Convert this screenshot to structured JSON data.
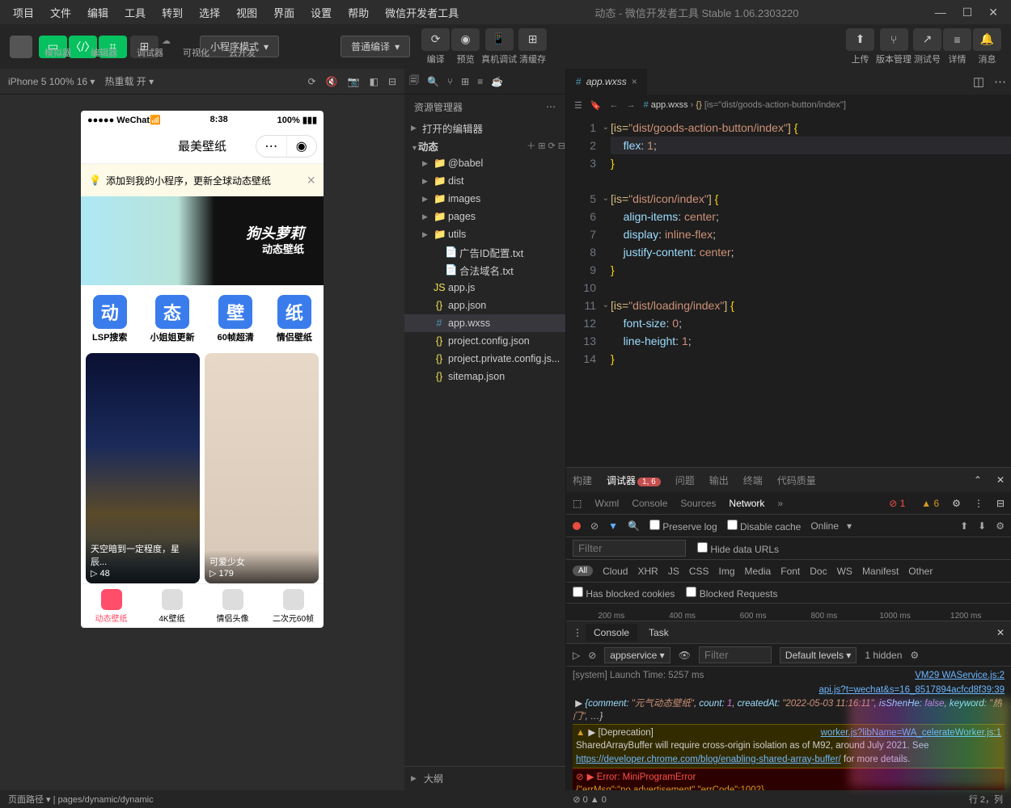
{
  "window": {
    "title": "动态 - 微信开发者工具 Stable 1.06.2303220"
  },
  "menu": [
    "项目",
    "文件",
    "编辑",
    "工具",
    "转到",
    "选择",
    "视图",
    "界面",
    "设置",
    "帮助",
    "微信开发者工具"
  ],
  "toolbar": {
    "cols": [
      "模拟器",
      "编辑器",
      "调试器",
      "可视化",
      "云开发"
    ],
    "mode": "小程序模式",
    "compile": "普通编译",
    "actions": [
      "编译",
      "预览",
      "真机调试",
      "清缓存"
    ],
    "right": [
      "上传",
      "版本管理",
      "测试号",
      "详情",
      "消息"
    ]
  },
  "device": {
    "name": "iPhone 5 100% 16",
    "hot": "热重载 开"
  },
  "phone": {
    "carrier": "WeChat",
    "time": "8:38",
    "battery": "100%",
    "appTitle": "最美壁纸",
    "notice": "添加到我的小程序，更新全球动态壁纸",
    "bannerTitle": "狗头萝莉",
    "bannerSub": "动态壁纸",
    "grid": [
      {
        "icon": "动",
        "label": "LSP搜索"
      },
      {
        "icon": "态",
        "label": "小姐姐更新"
      },
      {
        "icon": "壁",
        "label": "60帧超清"
      },
      {
        "icon": "纸",
        "label": "情侣壁纸"
      }
    ],
    "card1": {
      "title": "天空暗到一定程度，星辰...",
      "plays": "48"
    },
    "card2": {
      "title": "可爱少女",
      "plays": "179"
    },
    "tabs": [
      "动态壁纸",
      "4K壁纸",
      "情侣头像",
      "二次元60帧"
    ]
  },
  "explorer": {
    "title": "资源管理器",
    "openEditors": "打开的编辑器",
    "root": "动态",
    "outline": "大纲",
    "tree": [
      {
        "d": 1,
        "t": "folder",
        "n": "@babel"
      },
      {
        "d": 1,
        "t": "folder",
        "c": "#e06c75",
        "n": "dist"
      },
      {
        "d": 1,
        "t": "folder",
        "c": "#5ec17a",
        "n": "images"
      },
      {
        "d": 1,
        "t": "folder",
        "c": "#e06c75",
        "n": "pages"
      },
      {
        "d": 1,
        "t": "folder",
        "c": "#5ec17a",
        "n": "utils"
      },
      {
        "d": 2,
        "t": "txt",
        "n": "广告ID配置.txt"
      },
      {
        "d": 2,
        "t": "txt",
        "n": "合法域名.txt"
      },
      {
        "d": 1,
        "t": "js",
        "n": "app.js"
      },
      {
        "d": 1,
        "t": "json",
        "n": "app.json"
      },
      {
        "d": 1,
        "t": "css",
        "n": "app.wxss",
        "sel": true
      },
      {
        "d": 1,
        "t": "json",
        "n": "project.config.json"
      },
      {
        "d": 1,
        "t": "json",
        "n": "project.private.config.js..."
      },
      {
        "d": 1,
        "t": "json",
        "n": "sitemap.json"
      }
    ]
  },
  "editor": {
    "tab": "app.wxss",
    "crumb": [
      "app.wxss",
      "{}",
      " [is=\"dist/goods-action-button/index\"]"
    ],
    "lines": [
      {
        "n": 1,
        "t": "[is=\"dist/goods-action-button/index\"] {",
        "k": "sel",
        "fold": true
      },
      {
        "n": 2,
        "t": "    flex: 1;",
        "k": "prop",
        "hl": true
      },
      {
        "n": 3,
        "t": "}",
        "k": "close"
      },
      {
        "n": "",
        "t": ""
      },
      {
        "n": 5,
        "t": "[is=\"dist/icon/index\"] {",
        "k": "sel",
        "fold": true
      },
      {
        "n": 6,
        "t": "    align-items: center;",
        "k": "prop"
      },
      {
        "n": 7,
        "t": "    display: inline-flex;",
        "k": "prop"
      },
      {
        "n": 8,
        "t": "    justify-content: center;",
        "k": "prop"
      },
      {
        "n": 9,
        "t": "}",
        "k": "close"
      },
      {
        "n": 10,
        "t": ""
      },
      {
        "n": 11,
        "t": "[is=\"dist/loading/index\"] {",
        "k": "sel",
        "fold": true
      },
      {
        "n": 12,
        "t": "    font-size: 0;",
        "k": "prop"
      },
      {
        "n": 13,
        "t": "    line-height: 1;",
        "k": "prop"
      },
      {
        "n": 14,
        "t": "}",
        "k": "close"
      }
    ]
  },
  "devtools": {
    "tabs": [
      "构建",
      "调试器",
      "问题",
      "输出",
      "终端",
      "代码质量"
    ],
    "badge": "1, 6",
    "sub": [
      "Wxml",
      "Console",
      "Sources",
      "Network"
    ],
    "errCount": "1",
    "warnCount": "6",
    "preserve": "Preserve log",
    "disable": "Disable cache",
    "online": "Online",
    "filter": "Filter",
    "hide": "Hide data URLs",
    "types": [
      "All",
      "Cloud",
      "XHR",
      "JS",
      "CSS",
      "Img",
      "Media",
      "Font",
      "Doc",
      "WS",
      "Manifest",
      "Other"
    ],
    "blocked": "Has blocked cookies",
    "blockedReq": "Blocked Requests",
    "timeline": [
      "200 ms",
      "400 ms",
      "600 ms",
      "800 ms",
      "1000 ms",
      "1200 ms"
    ],
    "ctabs": [
      "Console",
      "Task"
    ],
    "ctx": "appservice",
    "levels": "Default levels",
    "hidden": "1 hidden",
    "log": {
      "launch": "[system] Launch Time: 5257 ms",
      "launchSrc": "VM29 WAService.js:2",
      "link1": "api.js?t=wechat&s=16_8517894acfcd8f39:39",
      "obj": "{comment: \"元气动态壁纸\", count: 1, createdAt: \"2022-05-03 11:16:11\", isShenHe: false, keyword: \"热门\", …}",
      "depTitle": "[Deprecation]",
      "depSrc": "worker.js?libName=WA_celerateWorker.js:1",
      "dep": "SharedArrayBuffer will require cross-origin isolation as of M92, around July 2021. See https://developer.chrome.com/blog/enabling-shared-array-buffer/ for more details.",
      "err": "Error: MiniProgramError",
      "errDet": "{\"errMsg\":\"no advertisement\",\"errCode\":1002}"
    }
  },
  "status": {
    "path": "页面路径",
    "pathVal": "pages/dynamic/dynamic",
    "probs": "0",
    "warns": "0",
    "pos": "行 2，列"
  }
}
